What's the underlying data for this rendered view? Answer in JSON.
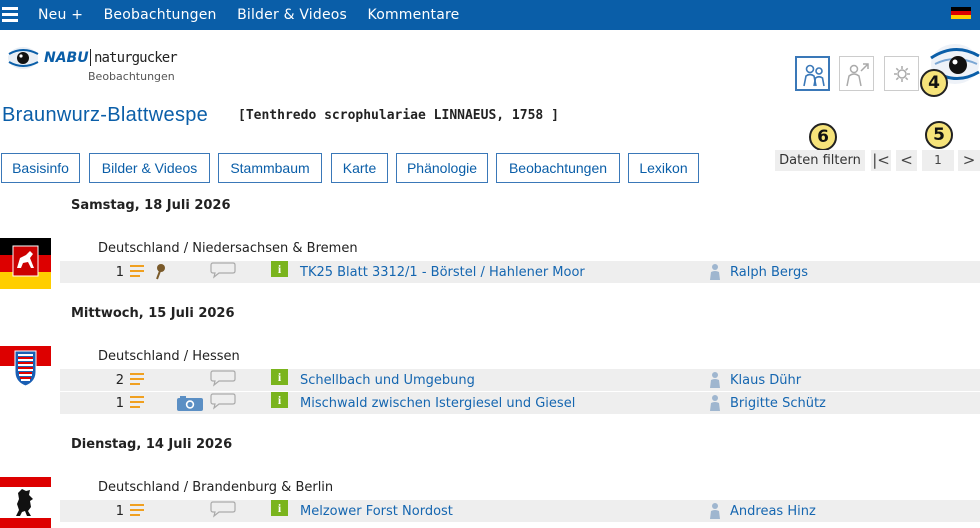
{
  "topnav": {
    "items": [
      "Neu +",
      "Beobachtungen",
      "Bilder & Videos",
      "Kommentare"
    ],
    "language_flag": "de-flag-icon"
  },
  "logo": {
    "nabu": "NABU",
    "name": "naturgucker",
    "sub": "Beobachtungen"
  },
  "header": {
    "title": "Braunwurz-Blattwespe",
    "scientific": "[Tenthredo scrophulariae LINNAEUS, 1758 ]"
  },
  "toolbar": {
    "filter_label": "Daten filtern",
    "first_label": "|<",
    "prev_label": "<",
    "page": "1",
    "next_label": ">"
  },
  "markers": [
    "4",
    "5",
    "6"
  ],
  "tabs": [
    "Basisinfo",
    "Bilder & Videos",
    "Stammbaum",
    "Karte",
    "Phänologie",
    "Beobachtungen",
    "Lexikon"
  ],
  "groups": [
    {
      "date": "Samstag, 18 Juli 2026",
      "region": "Deutschland / Niedersachsen & Bremen",
      "rows": [
        {
          "count": "1",
          "location": "TK25 Blatt 3312/1 - Börstel / Hahlener Moor",
          "observer": "Ralph Bergs"
        }
      ]
    },
    {
      "date": "Mittwoch, 15 Juli 2026",
      "region": "Deutschland / Hessen",
      "rows": [
        {
          "count": "2",
          "location": "Schellbach und Umgebung",
          "observer": "Klaus Dühr"
        },
        {
          "count": "1",
          "location": "Mischwald zwischen Istergiesel und Giesel",
          "observer": "Brigitte Schütz"
        }
      ]
    },
    {
      "date": "Dienstag, 14 Juli 2026",
      "region": "Deutschland / Brandenburg & Berlin",
      "rows": [
        {
          "count": "1",
          "location": "Melzower Forst Nordost",
          "observer": "Andreas Hinz"
        }
      ]
    }
  ],
  "colors": {
    "brand_blue": "#0a5ea8",
    "link_blue": "#1566b0",
    "info_green": "#7ab41d",
    "list_orange": "#f0a020"
  }
}
